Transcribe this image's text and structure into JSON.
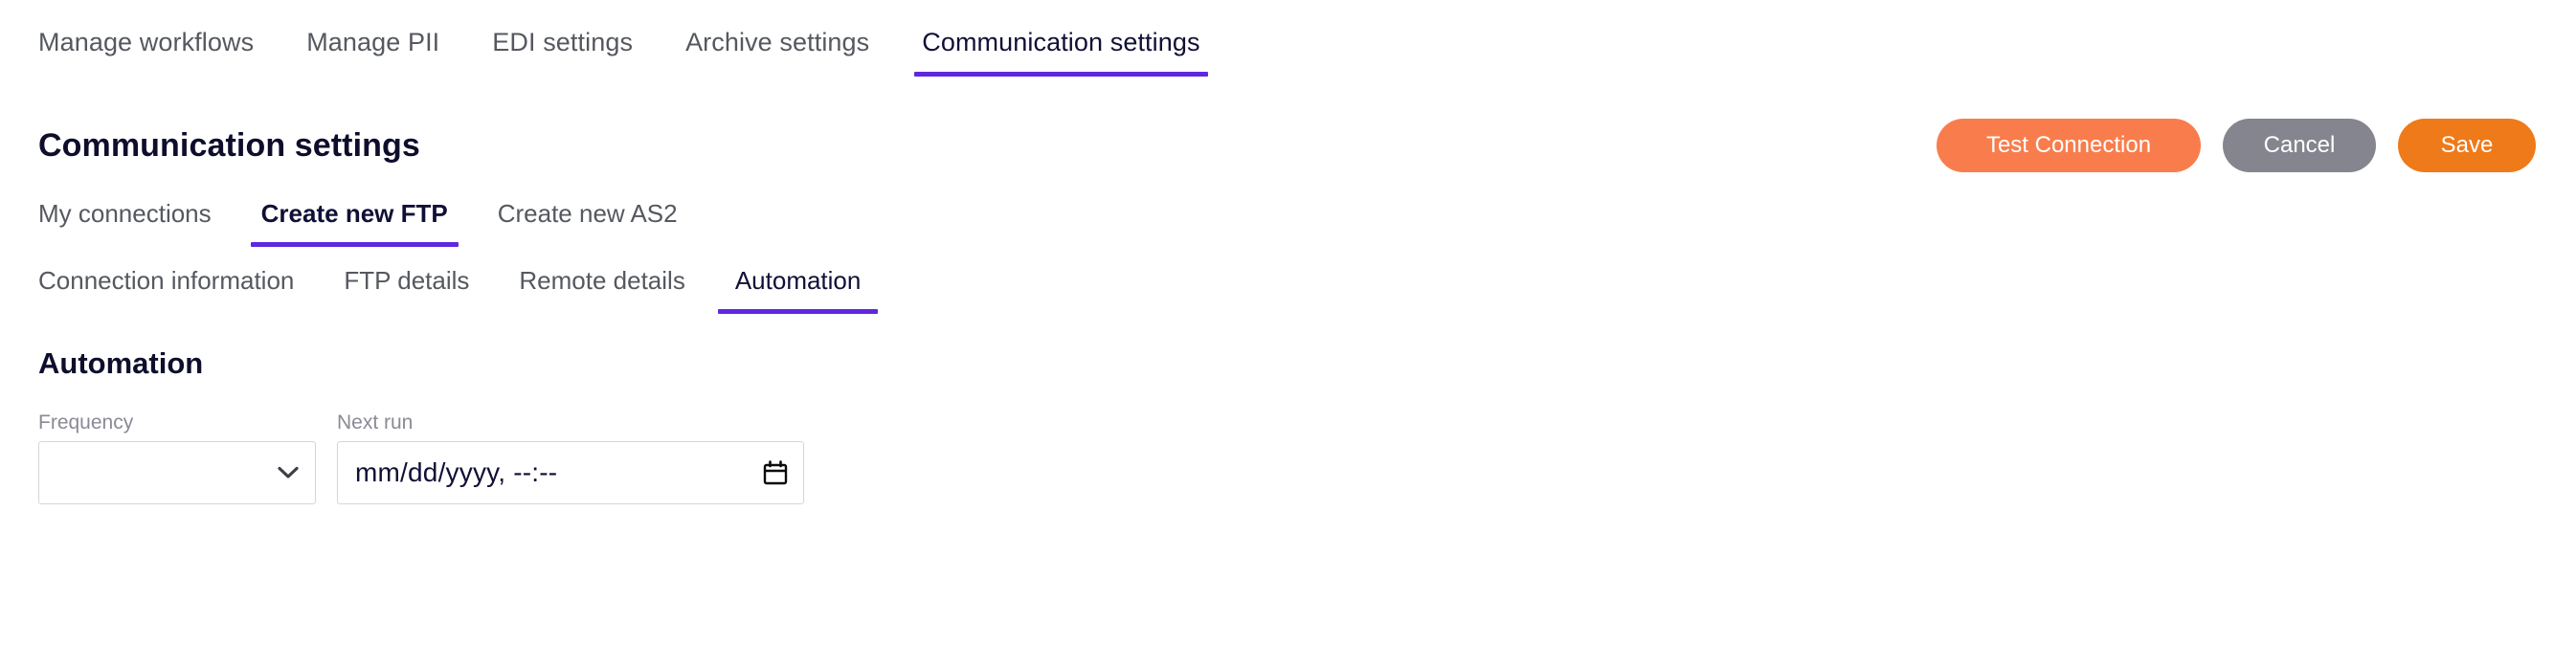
{
  "top_nav": {
    "items": [
      {
        "label": "Manage workflows",
        "active": false
      },
      {
        "label": "Manage PII",
        "active": false
      },
      {
        "label": "EDI settings",
        "active": false
      },
      {
        "label": "Archive settings",
        "active": false
      },
      {
        "label": "Communication settings",
        "active": true
      }
    ]
  },
  "header": {
    "title": "Communication settings",
    "buttons": {
      "test_connection": "Test Connection",
      "cancel": "Cancel",
      "save": "Save"
    }
  },
  "sub_nav": {
    "items": [
      {
        "label": "My connections",
        "active": false
      },
      {
        "label": "Create new FTP",
        "active": true
      },
      {
        "label": "Create new AS2",
        "active": false
      }
    ]
  },
  "tab_nav": {
    "items": [
      {
        "label": "Connection information",
        "active": false
      },
      {
        "label": "FTP details",
        "active": false
      },
      {
        "label": "Remote details",
        "active": false
      },
      {
        "label": "Automation",
        "active": true
      }
    ]
  },
  "section": {
    "title": "Automation",
    "fields": {
      "frequency": {
        "label": "Frequency",
        "value": "",
        "options": [
          ""
        ],
        "icon": "chevron-down-icon"
      },
      "next_run": {
        "label": "Next run",
        "value": "",
        "placeholder": "mm/dd/yyyy, --:--",
        "icon": "calendar-icon"
      }
    }
  },
  "colors": {
    "accent_purple": "#5f27e0",
    "btn_test": "#f97d4c",
    "btn_cancel": "#85858f",
    "btn_save": "#ef7a1a",
    "text_dark": "#0e0e2c",
    "text_muted": "#55585f",
    "label_muted": "#8a8a95",
    "border": "#d6d6da"
  }
}
